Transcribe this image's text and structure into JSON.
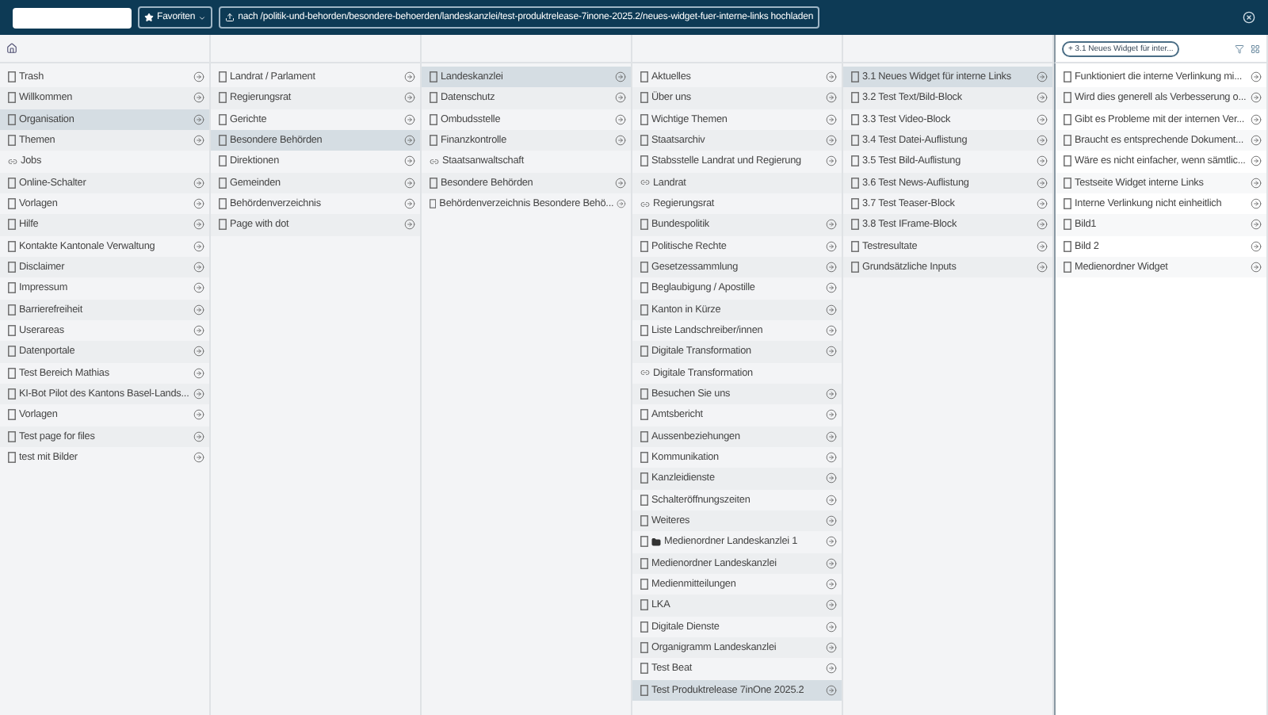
{
  "topbar": {
    "favorites": "Favoriten",
    "upload": "nach /politik-und-behorden/besondere-behoerden/landeskanzlei/test-produktrelease-7inone-2025.2/neues-widget-fuer-interne-links hochladen"
  },
  "filter_chip": "+ 3.1 Neues Widget für inter...",
  "columns": [
    {
      "items": [
        {
          "label": "Trash",
          "kind": "page",
          "selected": false
        },
        {
          "label": "Willkommen",
          "kind": "page",
          "selected": false
        },
        {
          "label": "Organisation",
          "kind": "page",
          "selected": true
        },
        {
          "label": "Themen",
          "kind": "page",
          "selected": false
        },
        {
          "label": "Jobs",
          "kind": "link",
          "selected": false
        },
        {
          "label": "Online-Schalter",
          "kind": "page",
          "selected": false
        },
        {
          "label": "Vorlagen",
          "kind": "page",
          "selected": false
        },
        {
          "label": "Hilfe",
          "kind": "page",
          "selected": false
        },
        {
          "label": "Kontakte Kantonale Verwaltung",
          "kind": "page",
          "selected": false
        },
        {
          "label": "Disclaimer",
          "kind": "page",
          "selected": false
        },
        {
          "label": "Impressum",
          "kind": "page",
          "selected": false
        },
        {
          "label": "Barrierefreiheit",
          "kind": "page",
          "selected": false
        },
        {
          "label": "Userareas",
          "kind": "page",
          "selected": false
        },
        {
          "label": "Datenportale",
          "kind": "page",
          "selected": false
        },
        {
          "label": "Test Bereich Mathias",
          "kind": "page",
          "selected": false
        },
        {
          "label": "KI-Bot Pilot des Kantons Basel-Lands...",
          "kind": "page",
          "selected": false
        },
        {
          "label": "Vorlagen",
          "kind": "page",
          "selected": false
        },
        {
          "label": "Test page for files",
          "kind": "page",
          "selected": false
        },
        {
          "label": "test mit Bilder",
          "kind": "page",
          "selected": false
        }
      ]
    },
    {
      "items": [
        {
          "label": "Landrat / Parlament",
          "kind": "page",
          "selected": false
        },
        {
          "label": "Regierungsrat",
          "kind": "page",
          "selected": false
        },
        {
          "label": "Gerichte",
          "kind": "page",
          "selected": false
        },
        {
          "label": "Besondere Behörden",
          "kind": "page",
          "selected": true
        },
        {
          "label": "Direktionen",
          "kind": "page",
          "selected": false
        },
        {
          "label": "Gemeinden",
          "kind": "page",
          "selected": false
        },
        {
          "label": "Behördenverzeichnis",
          "kind": "page",
          "selected": false
        },
        {
          "label": "Page with dot",
          "kind": "page",
          "selected": false
        }
      ]
    },
    {
      "items": [
        {
          "label": "Landeskanzlei",
          "kind": "page",
          "selected": true
        },
        {
          "label": "Datenschutz",
          "kind": "page",
          "selected": false
        },
        {
          "label": "Ombudsstelle",
          "kind": "page",
          "selected": false
        },
        {
          "label": "Finanzkontrolle",
          "kind": "page",
          "selected": false
        },
        {
          "label": "Staatsanwaltschaft",
          "kind": "link",
          "selected": false
        },
        {
          "label": "Besondere Behörden",
          "kind": "page",
          "selected": false
        },
        {
          "label": "Behördenverzeichnis Besondere Behö...",
          "kind": "page",
          "selected": false
        }
      ]
    },
    {
      "items": [
        {
          "label": "Aktuelles",
          "kind": "page",
          "selected": false
        },
        {
          "label": "Über uns",
          "kind": "page",
          "selected": false
        },
        {
          "label": "Wichtige Themen",
          "kind": "page",
          "selected": false
        },
        {
          "label": "Staatsarchiv",
          "kind": "page",
          "selected": false
        },
        {
          "label": "Stabsstelle Landrat und Regierung",
          "kind": "page",
          "selected": false
        },
        {
          "label": "Landrat",
          "kind": "link",
          "selected": false
        },
        {
          "label": "Regierungsrat",
          "kind": "link",
          "selected": false
        },
        {
          "label": "Bundespolitik",
          "kind": "page",
          "selected": false
        },
        {
          "label": "Politische Rechte",
          "kind": "page",
          "selected": false
        },
        {
          "label": "Gesetzessammlung",
          "kind": "page",
          "selected": false
        },
        {
          "label": "Beglaubigung / Apostille",
          "kind": "page",
          "selected": false
        },
        {
          "label": "Kanton in Kürze",
          "kind": "page",
          "selected": false
        },
        {
          "label": "Liste Landschreiber/innen",
          "kind": "page",
          "selected": false
        },
        {
          "label": "Digitale Transformation",
          "kind": "page",
          "selected": false
        },
        {
          "label": "Digitale Transformation",
          "kind": "link",
          "selected": false
        },
        {
          "label": "Besuchen Sie uns",
          "kind": "page",
          "selected": false
        },
        {
          "label": "Amtsbericht",
          "kind": "page",
          "selected": false
        },
        {
          "label": "Aussenbeziehungen",
          "kind": "page",
          "selected": false
        },
        {
          "label": "Kommunikation",
          "kind": "page",
          "selected": false
        },
        {
          "label": "Kanzleidienste",
          "kind": "page",
          "selected": false
        },
        {
          "label": "Schalteröffnungszeiten",
          "kind": "page",
          "selected": false
        },
        {
          "label": "Weiteres",
          "kind": "page",
          "selected": false
        },
        {
          "label": "Medienordner Landeskanzlei 1",
          "kind": "folder",
          "selected": false
        },
        {
          "label": "Medienordner Landeskanzlei",
          "kind": "page",
          "selected": false
        },
        {
          "label": "Medienmitteilungen",
          "kind": "page",
          "selected": false
        },
        {
          "label": "LKA",
          "kind": "page",
          "selected": false
        },
        {
          "label": "Digitale Dienste",
          "kind": "page",
          "selected": false
        },
        {
          "label": "Organigramm Landeskanzlei",
          "kind": "page",
          "selected": false
        },
        {
          "label": "Test Beat",
          "kind": "page",
          "selected": false
        },
        {
          "label": "Test Produktrelease 7inOne 2025.2",
          "kind": "page",
          "selected": true
        }
      ]
    },
    {
      "items": [
        {
          "label": "3.1 Neues Widget für interne Links",
          "kind": "page",
          "selected": true
        },
        {
          "label": "3.2 Test Text/Bild-Block",
          "kind": "page",
          "selected": false
        },
        {
          "label": "3.3 Test Video-Block",
          "kind": "page",
          "selected": false
        },
        {
          "label": "3.4 Test Datei-Auflistung",
          "kind": "page",
          "selected": false
        },
        {
          "label": "3.5 Test Bild-Auflistung",
          "kind": "page",
          "selected": false
        },
        {
          "label": "3.6 Test News-Auflistung",
          "kind": "page",
          "selected": false
        },
        {
          "label": "3.7 Test Teaser-Block",
          "kind": "page",
          "selected": false
        },
        {
          "label": "3.8 Test IFrame-Block",
          "kind": "page",
          "selected": false
        },
        {
          "label": "Testresultate",
          "kind": "page",
          "selected": false
        },
        {
          "label": "Grundsätzliche Inputs",
          "kind": "page",
          "selected": false
        }
      ]
    },
    {
      "items": [
        {
          "label": "Funktioniert die interne Verlinkung mi...",
          "kind": "page",
          "selected": false
        },
        {
          "label": "Wird dies generell als Verbesserung o...",
          "kind": "page",
          "selected": false
        },
        {
          "label": "Gibt es Probleme mit der internen Ver...",
          "kind": "page",
          "selected": false
        },
        {
          "label": "Braucht es entsprechende Dokument...",
          "kind": "page",
          "selected": false
        },
        {
          "label": "Wäre es nicht einfacher, wenn sämtlic...",
          "kind": "page",
          "selected": false
        },
        {
          "label": "Testseite Widget interne Links",
          "kind": "page",
          "selected": false
        },
        {
          "label": "Interne Verlinkung nicht einheitlich",
          "kind": "page",
          "selected": false
        },
        {
          "label": "Bild1",
          "kind": "page",
          "selected": false
        },
        {
          "label": "Bild 2",
          "kind": "page",
          "selected": false
        },
        {
          "label": "Medienordner Widget",
          "kind": "page",
          "selected": false
        }
      ]
    }
  ]
}
